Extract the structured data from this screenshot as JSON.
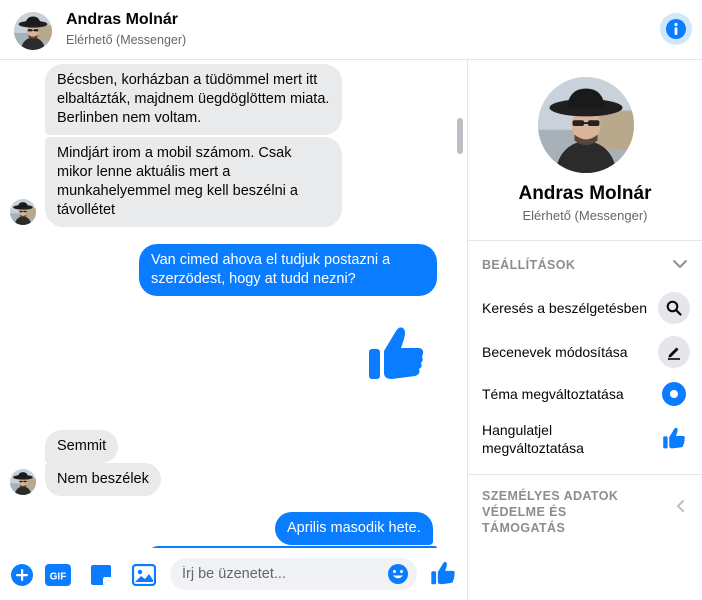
{
  "header": {
    "name": "Andras Molnár",
    "status": "Elérhető (Messenger)"
  },
  "messages": [
    {
      "from": "them",
      "text": "Bécsben, korházban a tüdömmel mert itt elbaltázták, majdnem üegdöglöttem miata. Berlinben nem voltam."
    },
    {
      "from": "them",
      "text": "Mindjárt irom a mobil számom. Csak mikor lenne aktuális mert a munkahelyemmel meg kell beszélni a távollétet"
    },
    {
      "from": "me",
      "text": "Van cimed ahova el tudjuk postazni a szerzödest, hogy at tudd nezni?"
    },
    {
      "from": "me",
      "type": "thumbs-up"
    },
    {
      "from": "them",
      "text": "Semmit"
    },
    {
      "from": "them",
      "text": "Nem beszélek"
    },
    {
      "from": "me",
      "text": "Aprilis masodik hete."
    }
  ],
  "composer": {
    "placeholder": "Írj be üzenetet..."
  },
  "panel": {
    "name": "Andras Molnár",
    "status": "Elérhető (Messenger)",
    "settings_title": "BEÁLLÍTÁSOK",
    "items": [
      {
        "label": "Keresés a beszélgetésben",
        "icon": "search-icon"
      },
      {
        "label": "Becenevek módosítása",
        "icon": "pencil-icon"
      },
      {
        "label": "Téma megváltoztatása",
        "icon": "theme-color-icon"
      },
      {
        "label": "Hangulatjel megváltoztatása",
        "icon": "thumbs-up-icon"
      }
    ],
    "privacy_title": "SZEMÉLYES ADATOK VÉDELME ÉS TÁMOGATÁS"
  },
  "colors": {
    "accent": "#0A7CFF",
    "incoming_bubble": "#E9EAEB",
    "muted_text": "#65676B"
  }
}
